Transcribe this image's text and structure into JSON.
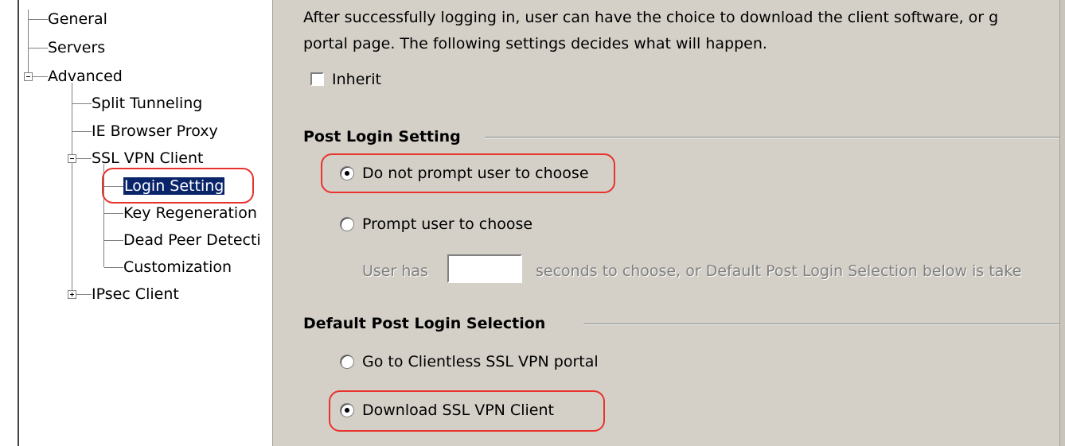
{
  "tree": {
    "items": [
      {
        "label": "General"
      },
      {
        "label": "Servers"
      },
      {
        "label": "Advanced"
      },
      {
        "label": "Split Tunneling"
      },
      {
        "label": "IE Browser Proxy"
      },
      {
        "label": "SSL VPN Client"
      },
      {
        "label": "Login Setting"
      },
      {
        "label": "Key Regeneration"
      },
      {
        "label": "Dead Peer Detecti"
      },
      {
        "label": "Customization"
      },
      {
        "label": "IPsec Client"
      }
    ]
  },
  "content": {
    "intro_line1": "After successfully logging in, user can have the choice to download the client software, or g",
    "intro_line2": "portal page. The following settings decides what will happen.",
    "inherit_label": "Inherit",
    "post_login": {
      "title": "Post Login Setting",
      "option1": "Do not prompt user to choose",
      "option2": "Prompt user to choose",
      "user_has": "User has",
      "seconds_text": "seconds to choose, or Default Post Login Selection below is take"
    },
    "default_selection": {
      "title": "Default Post Login Selection",
      "option1": "Go to Clientless SSL VPN portal",
      "option2": "Download SSL VPN Client"
    }
  },
  "colors": {
    "highlight_annotation": "#e8322d",
    "selection": "#0a246a",
    "dialog_bg": "#d4d0c8"
  }
}
